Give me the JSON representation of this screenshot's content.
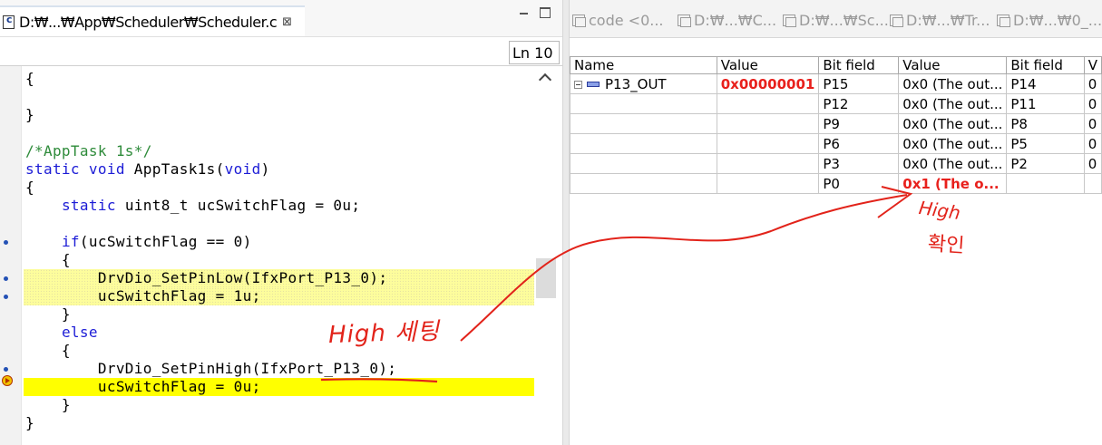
{
  "editor": {
    "tab_title": "D:₩...₩App₩Scheduler₩Scheduler.c",
    "tab_close": "⊠",
    "line_indicator": "Ln 10",
    "code_lines": [
      [
        {
          "t": "{",
          "c": "pl"
        }
      ],
      [],
      [
        {
          "t": "}",
          "c": "pl"
        }
      ],
      [],
      [
        {
          "t": "/*AppTask 1s*/",
          "c": "cm"
        }
      ],
      [
        {
          "t": "static void",
          "c": "kw"
        },
        {
          "t": " AppTask1s(",
          "c": "pl"
        },
        {
          "t": "void",
          "c": "kw"
        },
        {
          "t": ")",
          "c": "pl"
        }
      ],
      [
        {
          "t": "{",
          "c": "pl"
        }
      ],
      [
        {
          "t": "    ",
          "c": "pl"
        },
        {
          "t": "static",
          "c": "kw"
        },
        {
          "t": " uint8_t ucSwitchFlag = 0u;",
          "c": "pl"
        }
      ],
      [],
      [
        {
          "t": "    ",
          "c": "pl"
        },
        {
          "t": "if",
          "c": "kw"
        },
        {
          "t": "(ucSwitchFlag == 0)",
          "c": "pl"
        }
      ],
      [
        {
          "t": "    {",
          "c": "pl"
        }
      ],
      [
        {
          "t": "        DrvDio_SetPinLow(IfxPort_P13_0);",
          "c": "pl"
        }
      ],
      [
        {
          "t": "        ucSwitchFlag = 1u;",
          "c": "pl"
        }
      ],
      [
        {
          "t": "    }",
          "c": "pl"
        }
      ],
      [
        {
          "t": "    ",
          "c": "pl"
        },
        {
          "t": "else",
          "c": "kw"
        }
      ],
      [
        {
          "t": "    {",
          "c": "pl"
        }
      ],
      [
        {
          "t": "        DrvDio_SetPinHigh(IfxPort_P13_0);",
          "c": "pl"
        }
      ],
      [
        {
          "t": "        ucSwitchFlag = 0u;",
          "c": "pl"
        }
      ],
      [
        {
          "t": "    }",
          "c": "pl"
        }
      ],
      [
        {
          "t": "}",
          "c": "pl"
        }
      ]
    ],
    "highlight_light_lines": [
      11,
      12
    ],
    "highlight_current_line": 17,
    "breakpoint_lines": [
      9,
      11,
      12,
      16
    ]
  },
  "registers": {
    "tabs": [
      "code <0...",
      "D:₩...₩C...",
      "D:₩...₩Sc...",
      "D:₩...₩Tr...",
      "D:₩...₩0_..."
    ],
    "columns": [
      "Name",
      "Value",
      "Bit field",
      "Value",
      "Bit field",
      "V"
    ],
    "rows": [
      {
        "name": "P13_OUT",
        "value": "0x00000001",
        "bf1": "P15",
        "v1": "0x0 (The out...",
        "bf2": "P14",
        "v2": "0",
        "tree": true
      },
      {
        "name": "",
        "value": "",
        "bf1": "P12",
        "v1": "0x0 (The out...",
        "bf2": "P11",
        "v2": "0"
      },
      {
        "name": "",
        "value": "",
        "bf1": "P9",
        "v1": "0x0 (The out...",
        "bf2": "P8",
        "v2": "0"
      },
      {
        "name": "",
        "value": "",
        "bf1": "P6",
        "v1": "0x0 (The out...",
        "bf2": "P5",
        "v2": "0"
      },
      {
        "name": "",
        "value": "",
        "bf1": "P3",
        "v1": "0x0 (The out...",
        "bf2": "P2",
        "v2": "0"
      },
      {
        "name": "",
        "value": "",
        "bf1": "P0",
        "v1": "0x1 (The o...",
        "bf2": "",
        "v2": "",
        "v1_red": true
      }
    ]
  },
  "annotations": {
    "setting_note": "High 세팅",
    "high_note": "High",
    "confirm_note": "확인",
    "color": "#e2231a"
  },
  "colors": {
    "keyword": "#1c1cd6",
    "comment": "#2e8b3a",
    "current_line": "#ffff00",
    "changed_value": "#e8201c"
  }
}
